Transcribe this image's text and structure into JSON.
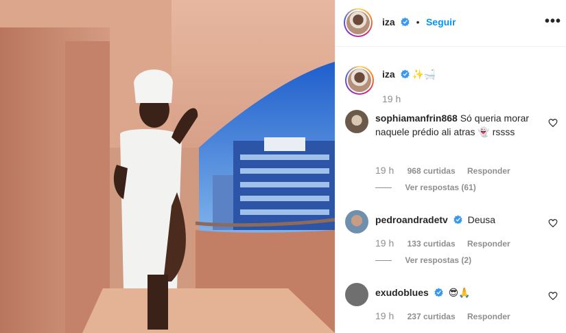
{
  "header": {
    "username": "iza",
    "follow_label": "Seguir",
    "separator": "•",
    "more": "•••"
  },
  "caption": {
    "username": "iza",
    "emojis": "✨🛁",
    "time": "19 h"
  },
  "comments": [
    {
      "username": "sophiamanfrin868",
      "text": "Só queria morar naquele prédio ali atras 👻 rssss",
      "time": "19 h",
      "likes": "968 curtidas",
      "reply_label": "Responder",
      "view_replies": "Ver respostas (61)",
      "verified": false
    },
    {
      "username": "pedroandradetv",
      "text": "Deusa",
      "time": "19 h",
      "likes": "133 curtidas",
      "reply_label": "Responder",
      "view_replies": "Ver respostas (2)",
      "verified": true
    },
    {
      "username": "exudoblues",
      "text": "😎🙏",
      "time": "19 h",
      "likes": "237 curtidas",
      "reply_label": "Responder",
      "verified": true
    }
  ],
  "colors": {
    "link": "#0095f6",
    "verified": "#3897f0",
    "muted": "#8e8e8e",
    "wall": "#c98c74",
    "sky": "#2f6fd1"
  },
  "icons": [
    "verified-badge-icon",
    "heart-icon",
    "more-options-icon"
  ]
}
